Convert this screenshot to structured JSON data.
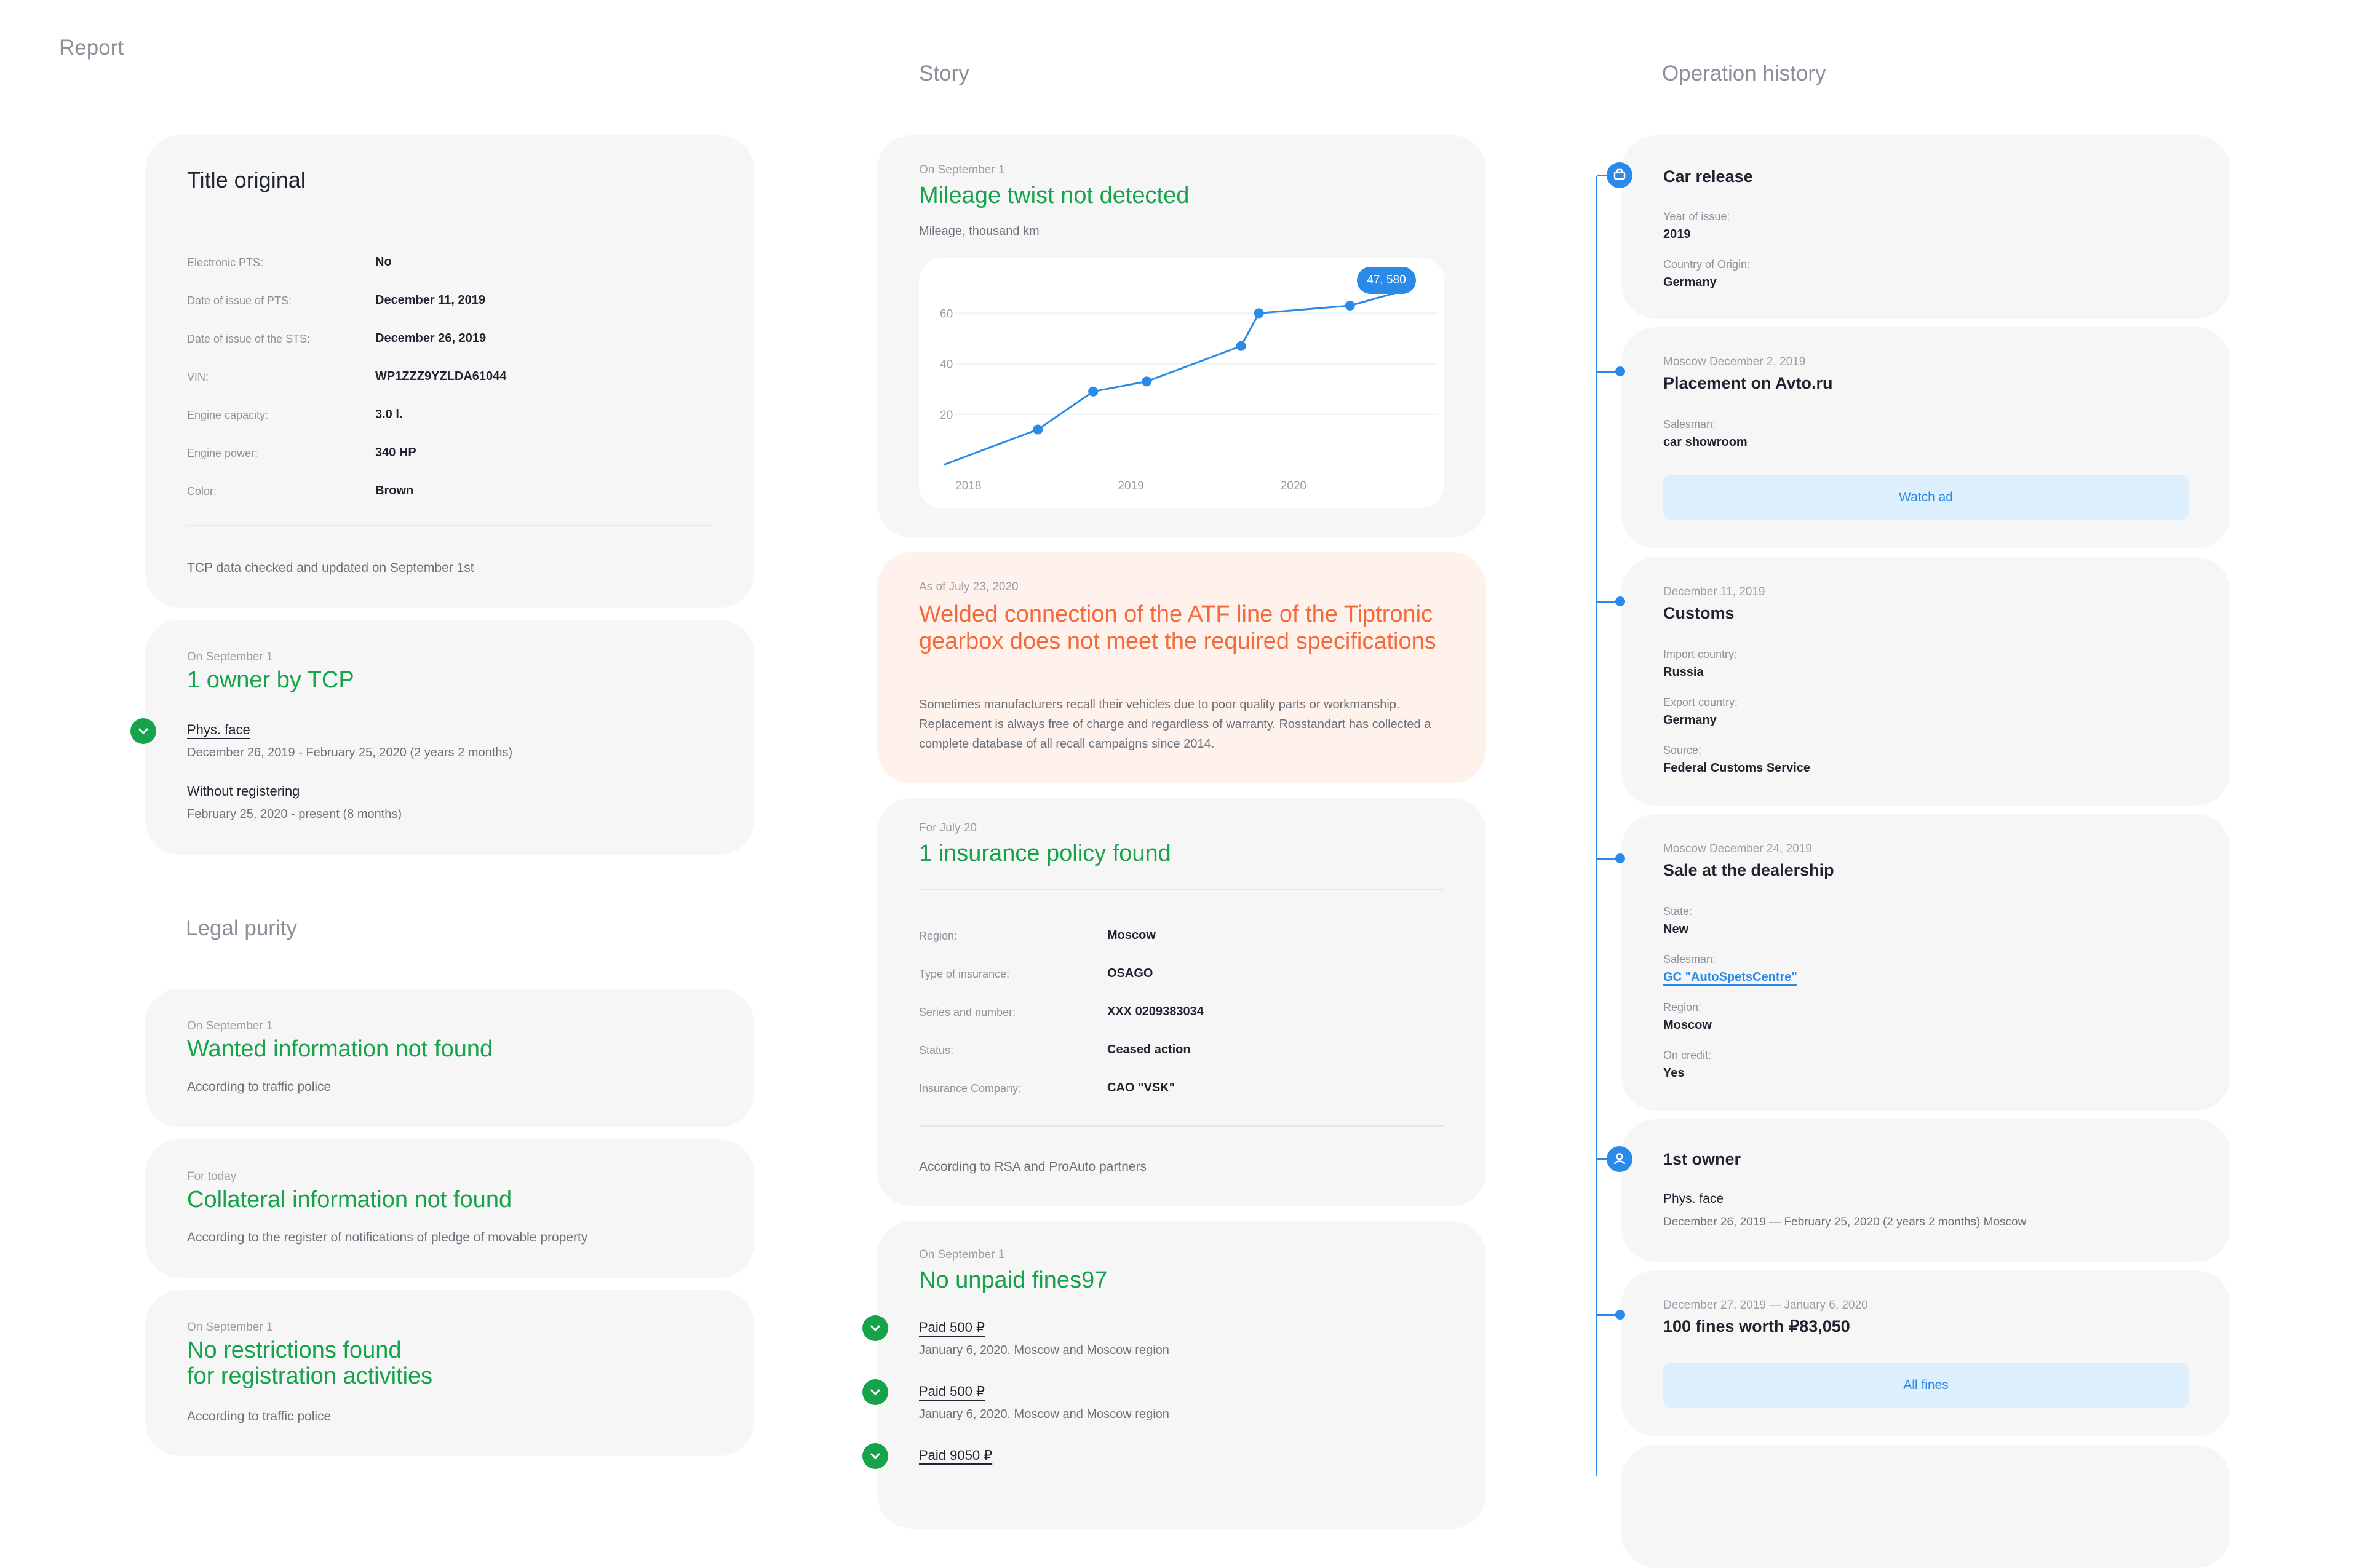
{
  "headings": {
    "report": "Report",
    "story": "Story",
    "operation_history": "Operation history",
    "legal_purity": "Legal purity"
  },
  "title_original": {
    "title": "Title original",
    "rows": [
      {
        "label": "Electronic PTS:",
        "value": "No"
      },
      {
        "label": "Date of issue of PTS:",
        "value": "December 11, 2019"
      },
      {
        "label": "Date of issue of the STS:",
        "value": "December 26, 2019"
      },
      {
        "label": "VIN:",
        "value": "WP1ZZZ9YZLDA61044"
      },
      {
        "label": "Engine capacity:",
        "value": "3.0 l."
      },
      {
        "label": "Engine power:",
        "value": "340 HP"
      },
      {
        "label": "Color:",
        "value": "Brown"
      }
    ],
    "footer": "TCP data checked and updated on September 1st"
  },
  "owners": {
    "date": "On September 1",
    "title": "1 owner by TCP",
    "owner1_name": "Phys. face",
    "owner1_period": "December 26, 2019 - February 25, 2020 (2 years 2 months)",
    "owner2_name": "Without registering",
    "owner2_period": "February 25, 2020 - present (8 months)"
  },
  "wanted": {
    "date": "On September 1",
    "title": "Wanted information not found",
    "source": "According to traffic police"
  },
  "collateral": {
    "date": "For today",
    "title": "Collateral information not found",
    "source": "According to the register of notifications of pledge of movable property"
  },
  "restrictions": {
    "date": "On September 1",
    "title_line1": "No restrictions found",
    "title_line2": "for registration activities",
    "source": "According to traffic police"
  },
  "mileage": {
    "date": "On September 1",
    "title": "Mileage twist not detected",
    "subtitle": "Mileage, thousand km",
    "badge": "47, 580"
  },
  "chart_data": {
    "type": "line",
    "title": "",
    "xlabel": "",
    "ylabel": "Mileage, thousand km",
    "x_ticks": [
      "2018",
      "2019",
      "2020"
    ],
    "y_ticks": [
      20,
      40,
      60
    ],
    "xlim": [
      2017.92,
      2021.0
    ],
    "ylim": [
      0,
      72
    ],
    "grid": true,
    "series": [
      {
        "x": [
          2017.92,
          2018.5,
          2018.84,
          2019.17,
          2019.75,
          2019.86,
          2020.42,
          2020.7
        ],
        "y": [
          0,
          14,
          29,
          33,
          47,
          60,
          63,
          68
        ],
        "markers": [
          false,
          true,
          true,
          true,
          true,
          true,
          true,
          false
        ]
      }
    ]
  },
  "recall": {
    "date": "As of July 23, 2020",
    "title_line1": "Welded connection of the ATF line of the Tiptronic",
    "title_line2": "gearbox does not meet the required specifications",
    "body_line1": "Sometimes manufacturers recall their vehicles due to poor quality parts or workmanship.",
    "body_line2": "Replacement is always free of charge and regardless of warranty. Rosstandart has collected a",
    "body_line3": "complete database of all recall campaigns since 2014."
  },
  "insurance": {
    "date": "For July 20",
    "title": "1 insurance policy found",
    "rows": [
      {
        "label": "Region:",
        "value": "Moscow"
      },
      {
        "label": "Type of insurance:",
        "value": "OSAGO"
      },
      {
        "label": "Series and number:",
        "value": "XXX 0209383034"
      },
      {
        "label": "Status:",
        "value": "Ceased action"
      },
      {
        "label": "Insurance Company:",
        "value": "CAO \"VSK\""
      }
    ],
    "footer": "According to RSA and ProAuto partners"
  },
  "fines": {
    "date": "On September 1",
    "title": "No unpaid fines97",
    "items": [
      {
        "label": "Paid 500 ₽",
        "meta": "January 6, 2020. Moscow and Moscow region"
      },
      {
        "label": "Paid 500 ₽",
        "meta": "January 6, 2020. Moscow and Moscow region"
      },
      {
        "label": "Paid 9050 ₽",
        "meta": ""
      }
    ]
  },
  "operations": {
    "car_release": {
      "title": "Car release",
      "year_label": "Year of issue:",
      "year_value": "2019",
      "country_label": "Country of Origin:",
      "country_value": "Germany"
    },
    "placement": {
      "date": "Moscow December 2, 2019",
      "title": "Placement on Avto.ru",
      "salesman_label": "Salesman:",
      "salesman_value": "car showroom",
      "button": "Watch ad"
    },
    "customs": {
      "date": "December 11, 2019",
      "title": "Customs",
      "import_label": "Import country:",
      "import_value": "Russia",
      "export_label": "Export country:",
      "export_value": "Germany",
      "source_label": "Source:",
      "source_value": "Federal Customs Service"
    },
    "sale": {
      "date": "Moscow December 24, 2019",
      "title": "Sale at the dealership",
      "state_label": "State:",
      "state_value": "New",
      "salesman_label": "Salesman:",
      "salesman_value": "GC \"AutoSpetsCentre\"",
      "region_label": "Region:",
      "region_value": "Moscow",
      "credit_label": "On credit:",
      "credit_value": "Yes"
    },
    "first_owner": {
      "title": "1st owner",
      "name": "Phys. face",
      "period": "December 26, 2019 — February 25, 2020 (2 years 2 months) Moscow"
    },
    "fines_op": {
      "date": "December 27, 2019 — January 6, 2020",
      "title": "100 fines worth ₽83,050",
      "button": "All fines"
    }
  },
  "colors": {
    "green": "#16a34a",
    "orange": "#f26b3a",
    "blue": "#2b8ae8",
    "card_bg": "#f6f6f7",
    "recall_bg": "#fff1ec"
  }
}
